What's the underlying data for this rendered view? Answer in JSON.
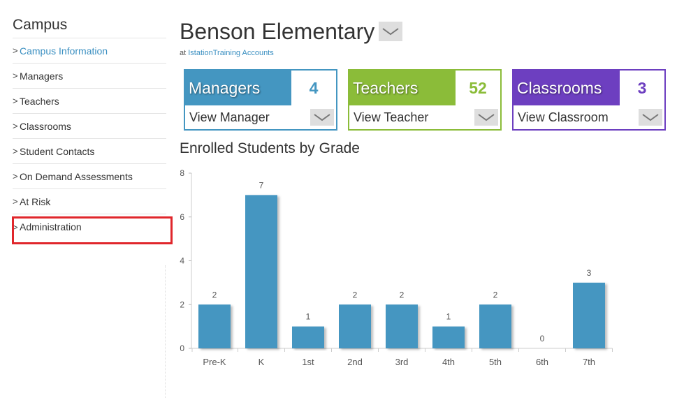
{
  "sidebar": {
    "title": "Campus",
    "items": [
      {
        "label": "Campus Information",
        "chevron": ">"
      },
      {
        "label": "Managers",
        "chevron": ">"
      },
      {
        "label": "Teachers",
        "chevron": ">"
      },
      {
        "label": "Classrooms",
        "chevron": ">"
      },
      {
        "label": "Student Contacts",
        "chevron": ">"
      },
      {
        "label": "On Demand Assessments",
        "chevron": ">"
      },
      {
        "label": "At Risk",
        "chevron": ">"
      },
      {
        "label": "Administration",
        "chevron": ">"
      }
    ]
  },
  "header": {
    "title": "Benson Elementary",
    "subtitle_prefix": "at",
    "account_link": "IstationTraining Accounts"
  },
  "cards": [
    {
      "label": "Managers",
      "count": "4",
      "action": "View Manager",
      "color": "#4496c1"
    },
    {
      "label": "Teachers",
      "count": "52",
      "action": "View Teacher",
      "color": "#8bbc39"
    },
    {
      "label": "Classrooms",
      "count": "3",
      "action": "View Classroom",
      "color": "#6d3fc0"
    }
  ],
  "chart_data": {
    "type": "bar",
    "title": "Enrolled Students by Grade",
    "categories": [
      "Pre-K",
      "K",
      "1st",
      "2nd",
      "3rd",
      "4th",
      "5th",
      "6th",
      "7th"
    ],
    "values": [
      2,
      7,
      1,
      2,
      2,
      1,
      2,
      0,
      3
    ],
    "ylim": [
      0,
      8
    ],
    "yticks": [
      0,
      2,
      4,
      6,
      8
    ],
    "bar_color": "#4496c1"
  }
}
